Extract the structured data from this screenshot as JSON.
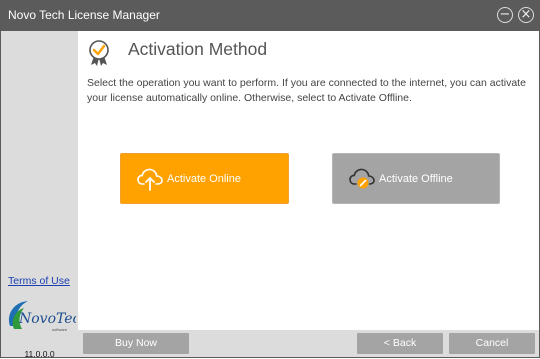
{
  "window": {
    "title": "Novo Tech License Manager"
  },
  "titlebar": {
    "minimize_icon": "minimize-circle-icon",
    "close_icon": "close-circle-icon",
    "minimize_glyph": "−",
    "close_glyph": "×"
  },
  "sidebar": {
    "terms_link": "Terms of Use",
    "logo_text": "NovoTech",
    "logo_subtext": "software",
    "version": "11.0.0.0"
  },
  "main": {
    "heading_icon": "award-badge-icon",
    "heading": "Activation Method",
    "description": "Select the operation you want to perform. If you are connected to the internet, you can activate your license automatically online. Otherwise, select to Activate Offline.",
    "options": [
      {
        "label": "Activate Online",
        "icon": "cloud-upload-icon",
        "color": "#ffa200"
      },
      {
        "label": "Activate Offline",
        "icon": "cloud-offline-icon",
        "color": "#a4a4a4"
      }
    ]
  },
  "footer": {
    "buy_now": "Buy Now",
    "back": "< Back",
    "cancel": "Cancel"
  },
  "colors": {
    "titlebar": "#5b5b5b",
    "sidebar": "#dcdcdc",
    "accent": "#ffa200",
    "button_gray": "#a4a4a4",
    "link": "#1a3fb0"
  }
}
